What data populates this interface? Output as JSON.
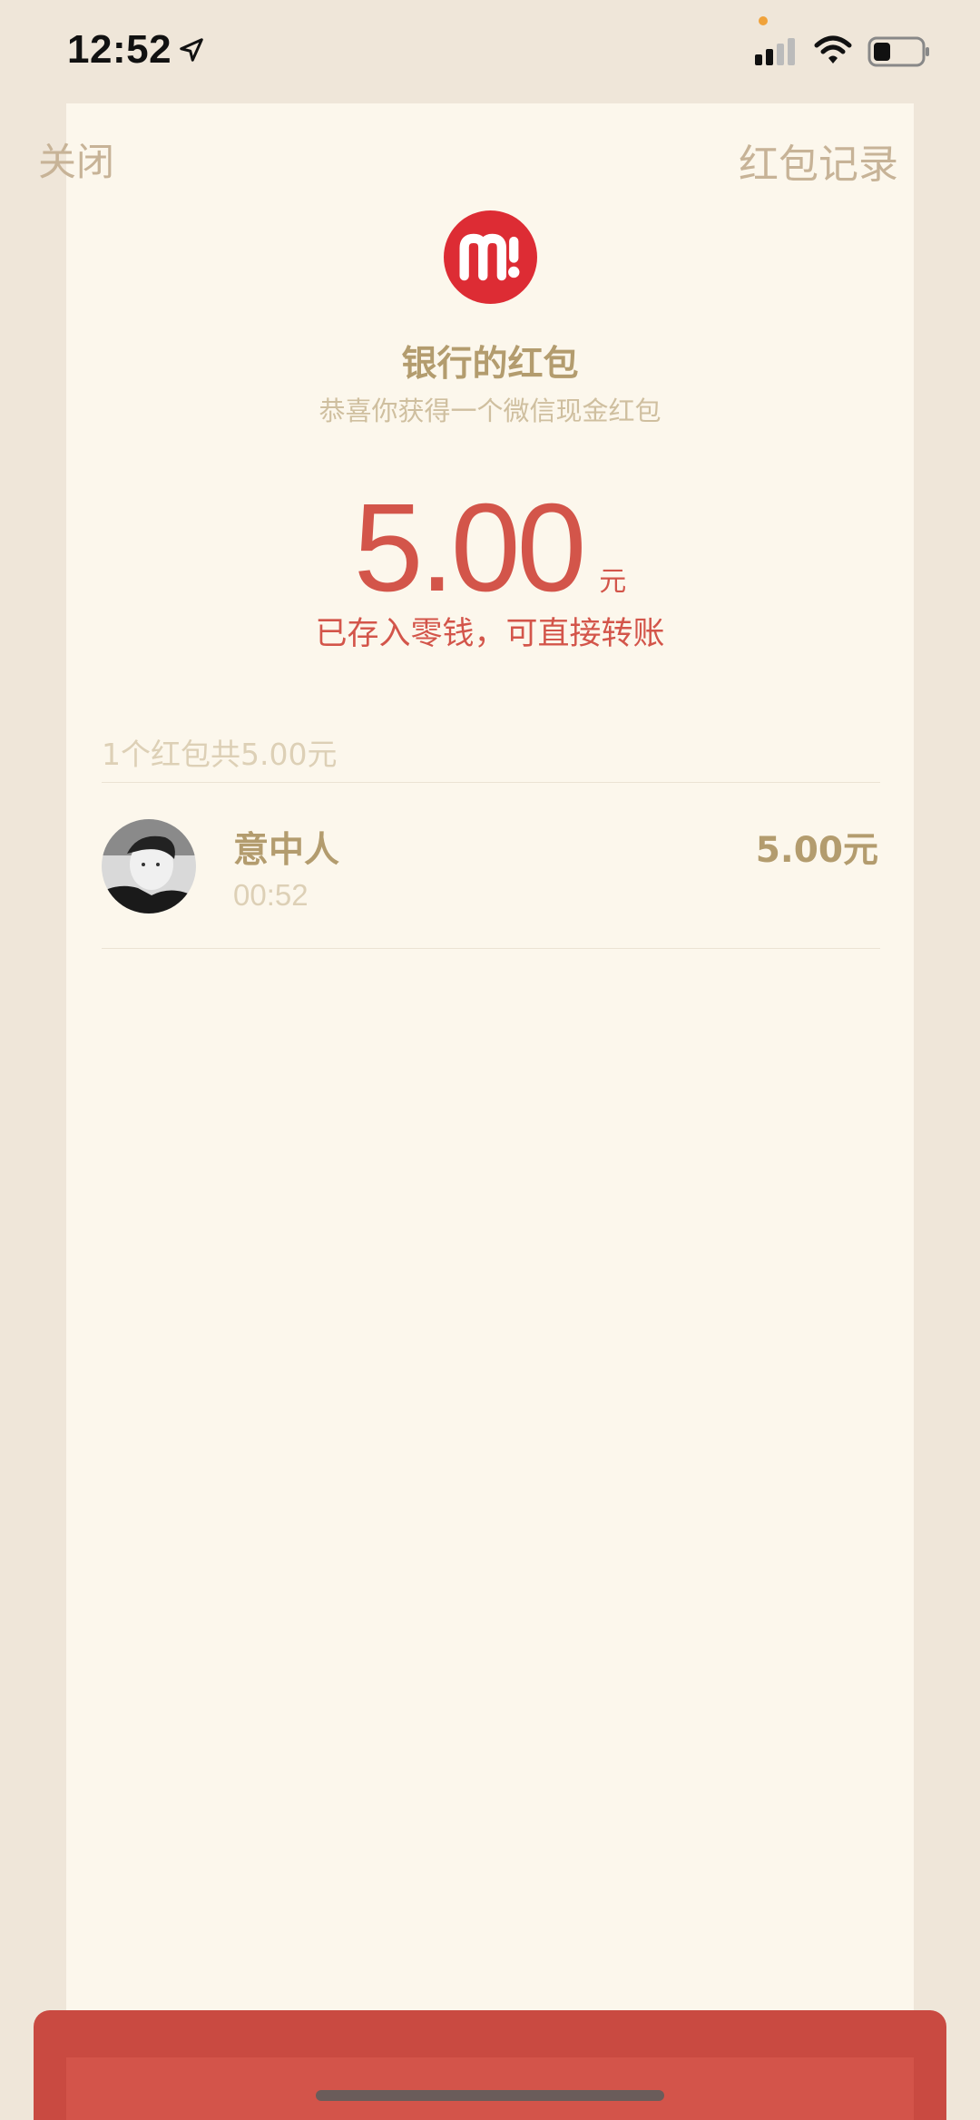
{
  "status_bar": {
    "time": "12:52",
    "icons": [
      "location-arrow-icon",
      "signal-icon",
      "wifi-icon",
      "battery-icon"
    ]
  },
  "header": {
    "close_label": "关闭",
    "records_label": "红包记录"
  },
  "packet": {
    "logo_icon": "bank-logo-icon",
    "sender_title": "银行的红包",
    "subtitle": "恭喜你获得一个微信现金红包",
    "amount": "5.00",
    "amount_unit": "元",
    "amount_note": "已存入零钱，可直接转账"
  },
  "summary": {
    "text": "1个红包共5.00元"
  },
  "receivers": [
    {
      "name": "意中人",
      "time": "00:52",
      "amount": "5.00元"
    }
  ],
  "colors": {
    "background": "#efe6d9",
    "panel": "#fcf7ec",
    "gold_text": "#b39c6e",
    "light_gold_text": "#cfbf9f",
    "red_accent": "#d3554a",
    "logo_red": "#dd2c34"
  }
}
